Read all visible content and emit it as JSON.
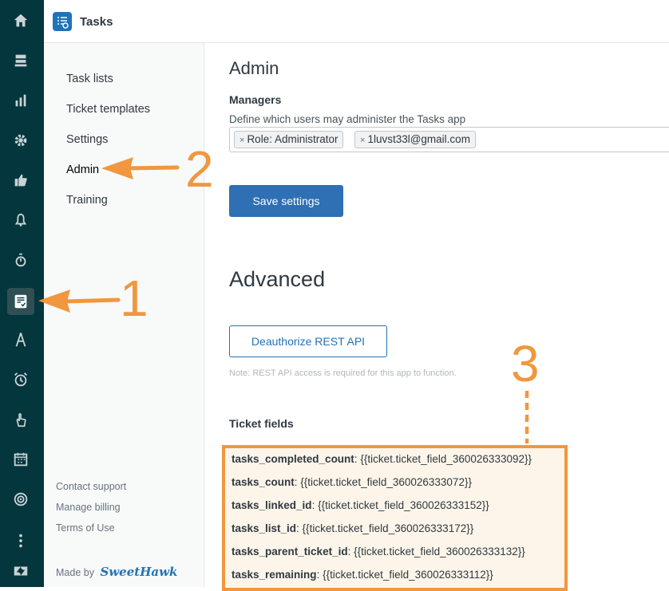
{
  "app": {
    "title": "Tasks"
  },
  "sidebar_nav": {
    "items": [
      {
        "label": "Task lists"
      },
      {
        "label": "Ticket templates"
      },
      {
        "label": "Settings"
      },
      {
        "label": "Admin"
      },
      {
        "label": "Training"
      }
    ],
    "footer": {
      "contact": "Contact support",
      "billing": "Manage billing",
      "terms": "Terms of Use",
      "made_by": "Made by",
      "brand": "SweetHawk"
    }
  },
  "admin": {
    "heading": "Admin",
    "managers_label": "Managers",
    "managers_hint": "Define which users may administer the Tasks app",
    "managers": [
      "Role: Administrator",
      "1luvst33l@gmail.com"
    ],
    "tag_remove": "×",
    "save_button": "Save settings"
  },
  "advanced": {
    "heading": "Advanced",
    "deauth_button": "Deauthorize REST API",
    "note": "Note: REST API access is required for this app to function.",
    "ticket_fields_label": "Ticket fields",
    "fields": [
      {
        "name": "tasks_completed_count",
        "value": ": {{ticket.ticket_field_360026333092}}"
      },
      {
        "name": "tasks_count",
        "value": ": {{ticket.ticket_field_360026333072}}"
      },
      {
        "name": "tasks_linked_id",
        "value": ": {{ticket.ticket_field_360026333152}}"
      },
      {
        "name": "tasks_list_id",
        "value": ": {{ticket.ticket_field_360026333172}}"
      },
      {
        "name": "tasks_parent_ticket_id",
        "value": ": {{ticket.ticket_field_360026333132}}"
      },
      {
        "name": "tasks_remaining",
        "value": ": {{ticket.ticket_field_360026333112}}"
      }
    ]
  },
  "annotations": {
    "one": "1",
    "two": "2",
    "three": "3",
    "color": "#f0973f"
  },
  "colors": {
    "rail": "#03363d",
    "primary": "#1f73b7",
    "annotation": "#f0973f"
  }
}
